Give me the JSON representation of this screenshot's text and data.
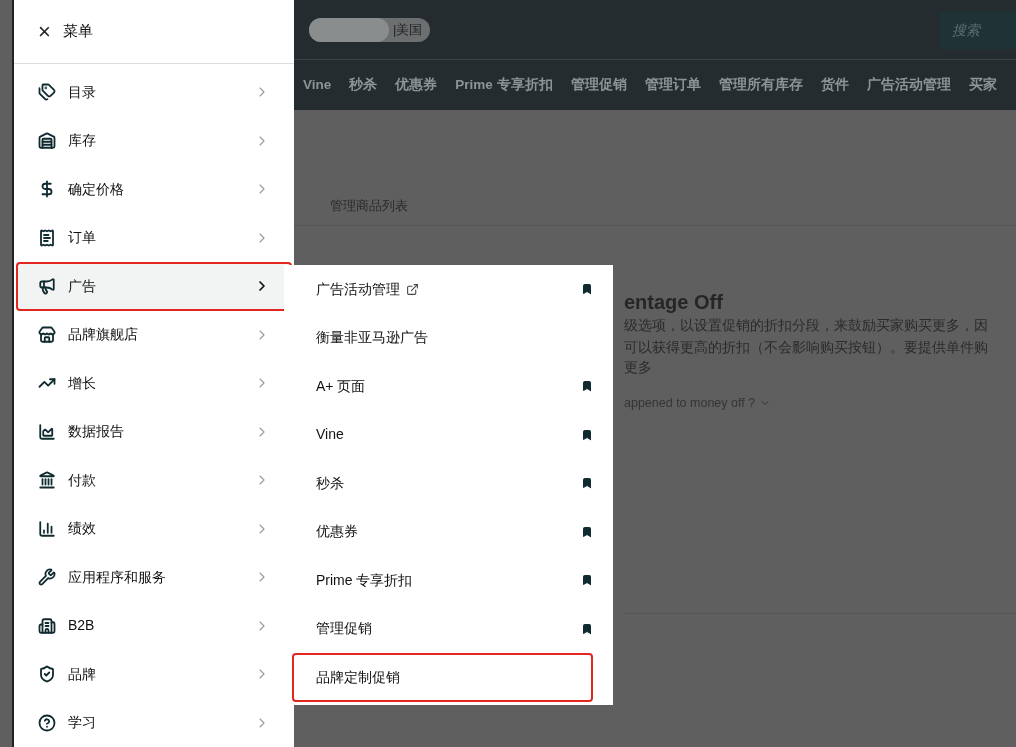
{
  "menu": {
    "close_label": "×",
    "title": "菜单",
    "items": [
      {
        "kind": "catalog",
        "label": "目录",
        "selected": false,
        "highlighted": false
      },
      {
        "kind": "inventory",
        "label": "库存",
        "selected": false,
        "highlighted": false
      },
      {
        "kind": "pricing",
        "label": "确定价格",
        "selected": false,
        "highlighted": false
      },
      {
        "kind": "orders",
        "label": "订单",
        "selected": false,
        "highlighted": false
      },
      {
        "kind": "advertising",
        "label": "广告",
        "selected": true,
        "highlighted": true
      },
      {
        "kind": "stores",
        "label": "品牌旗舰店",
        "selected": false,
        "highlighted": false
      },
      {
        "kind": "growth",
        "label": "增长",
        "selected": false,
        "highlighted": false
      },
      {
        "kind": "reports",
        "label": "数据报告",
        "selected": false,
        "highlighted": false
      },
      {
        "kind": "payments",
        "label": "付款",
        "selected": false,
        "highlighted": false
      },
      {
        "kind": "performance",
        "label": "绩效",
        "selected": false,
        "highlighted": false
      },
      {
        "kind": "apps",
        "label": "应用程序和服务",
        "selected": false,
        "highlighted": false
      },
      {
        "kind": "b2b",
        "label": "B2B",
        "selected": false,
        "highlighted": false
      },
      {
        "kind": "brands",
        "label": "品牌",
        "selected": false,
        "highlighted": false
      },
      {
        "kind": "learn",
        "label": "学习",
        "selected": false,
        "highlighted": false
      }
    ]
  },
  "submenu": {
    "items": [
      {
        "label": "广告活动管理",
        "external": true,
        "bookmarked": true,
        "highlighted": false
      },
      {
        "label": "衡量非亚马逊广告",
        "external": false,
        "bookmarked": false,
        "highlighted": false
      },
      {
        "label": "A+ 页面",
        "external": false,
        "bookmarked": true,
        "highlighted": false
      },
      {
        "label": "Vine",
        "external": false,
        "bookmarked": true,
        "highlighted": false
      },
      {
        "label": "秒杀",
        "external": false,
        "bookmarked": true,
        "highlighted": false
      },
      {
        "label": "优惠券",
        "external": false,
        "bookmarked": true,
        "highlighted": false
      },
      {
        "label": "Prime 专享折扣",
        "external": false,
        "bookmarked": true,
        "highlighted": false
      },
      {
        "label": "管理促销",
        "external": false,
        "bookmarked": true,
        "highlighted": false
      },
      {
        "label": "品牌定制促销",
        "external": false,
        "bookmarked": false,
        "highlighted": true
      }
    ]
  },
  "top_bar": {
    "marketplace": "|美国",
    "search": {
      "placeholder": "搜索"
    }
  },
  "nav": [
    "Vine",
    "秒杀",
    "优惠券",
    "Prime 专享折扣",
    "管理促销",
    "管理订单",
    "管理所有库存",
    "货件",
    "广告活动管理",
    "买家"
  ],
  "page": {
    "breadcrumb": "管理商品列表",
    "heading": "entage Off",
    "paragraph_lines": [
      "级选项，以设置促销的折扣分段，来鼓励买家购买更多，因",
      "可以获得更高的折扣（不会影响购买按钮）。要提供单件购"
    ],
    "learn_more": "更多",
    "faq": "appened to money off ?"
  }
}
